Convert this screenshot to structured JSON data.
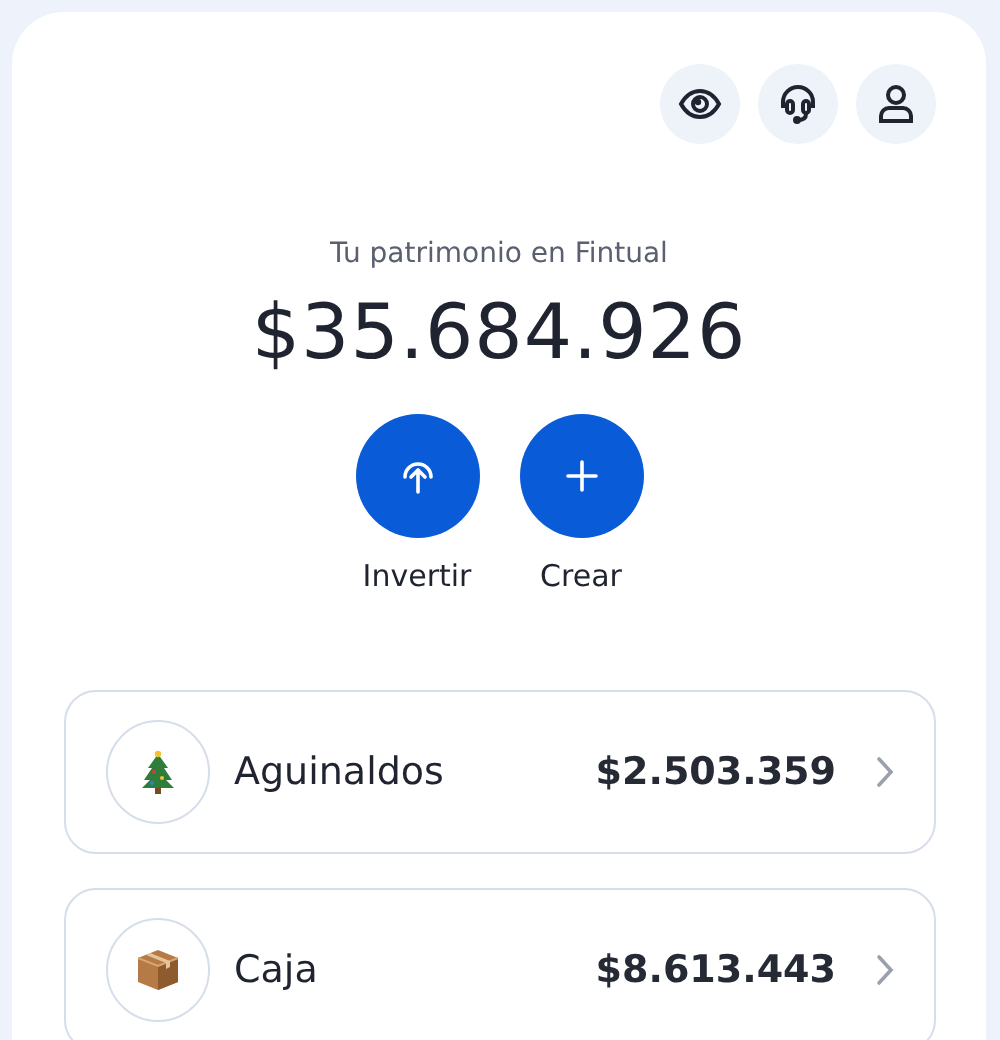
{
  "summary": {
    "label": "Tu patrimonio en Fintual",
    "amount": "$35.684.926"
  },
  "actions": [
    {
      "kind": "invest",
      "label": "Invertir"
    },
    {
      "kind": "create",
      "label": "Crear"
    }
  ],
  "goals": [
    {
      "kind": "tree",
      "name": "Aguinaldos",
      "amount": "$2.503.359"
    },
    {
      "kind": "box",
      "name": "Caja",
      "amount": "$8.613.443"
    }
  ]
}
